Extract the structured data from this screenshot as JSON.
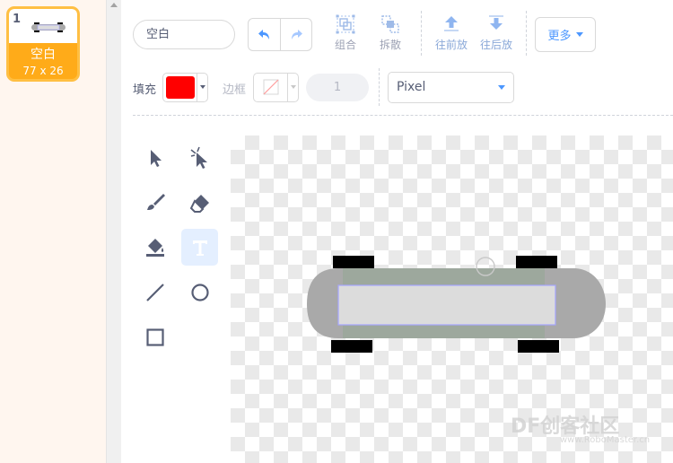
{
  "costume": {
    "number": "1",
    "name": "空白",
    "size": "77 x 26"
  },
  "toolbar": {
    "costume_name_value": "空白",
    "group_label": "组合",
    "ungroup_label": "拆散",
    "forward_label": "往前放",
    "backward_label": "往后放",
    "more_label": "更多"
  },
  "fill": {
    "label": "填充",
    "color": "#ff0000"
  },
  "outline": {
    "label": "边框",
    "width_value": "1"
  },
  "mode": {
    "selected": "Pixel"
  },
  "tools": [
    "select-arrow-icon",
    "reshape-icon",
    "brush-icon",
    "eraser-icon",
    "fill-bucket-icon",
    "text-icon",
    "line-icon",
    "circle-icon",
    "rectangle-icon"
  ],
  "colors": {
    "accent_orange": "#ffab19",
    "accent_blue": "#4c97ff",
    "selection_outline": "#a5a5ff"
  },
  "watermark": {
    "text": "DF创客社区",
    "sub": "www.RoboMaster.cn"
  }
}
